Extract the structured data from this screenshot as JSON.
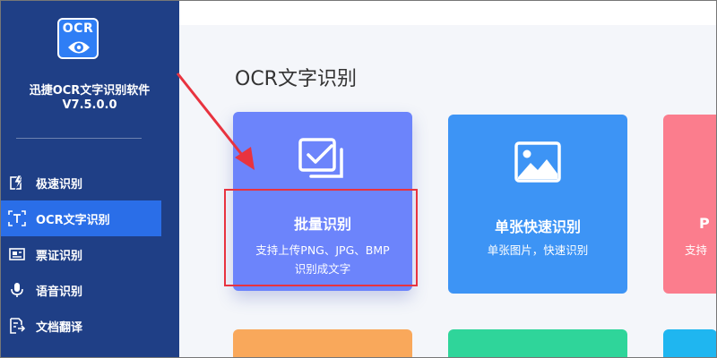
{
  "app": {
    "logo_text": "OCR",
    "name": "迅捷OCR文字识别软件",
    "version": "V7.5.0.0"
  },
  "sidebar": {
    "items": [
      {
        "label": "极速识别",
        "icon": "lightning-icon"
      },
      {
        "label": "OCR文字识别",
        "icon": "text-scan-icon",
        "active": true
      },
      {
        "label": "票证识别",
        "icon": "ticket-icon"
      },
      {
        "label": "语音识别",
        "icon": "microphone-icon"
      },
      {
        "label": "文档翻译",
        "icon": "document-translate-icon"
      }
    ]
  },
  "main": {
    "title": "OCR文字识别",
    "cards": [
      {
        "title": "批量识别",
        "desc_line1": "支持上传PNG、JPG、BMP",
        "desc_line2": "识别成文字",
        "icon": "batch-check-icon",
        "color": "#6c84fb"
      },
      {
        "title": "单张快速识别",
        "desc_line1": "单张图片，快速识别",
        "icon": "image-icon",
        "color": "#3d94f5"
      },
      {
        "title": "P",
        "desc_line1": "支持",
        "color": "#fb7d8d"
      }
    ],
    "bottom_card_colors": [
      "#f9a85b",
      "#2fd59a",
      "#1fb6f0"
    ]
  },
  "colors": {
    "sidebar": "#1f3f86",
    "active": "#2a6ee8",
    "annotation": "#e8333f"
  }
}
